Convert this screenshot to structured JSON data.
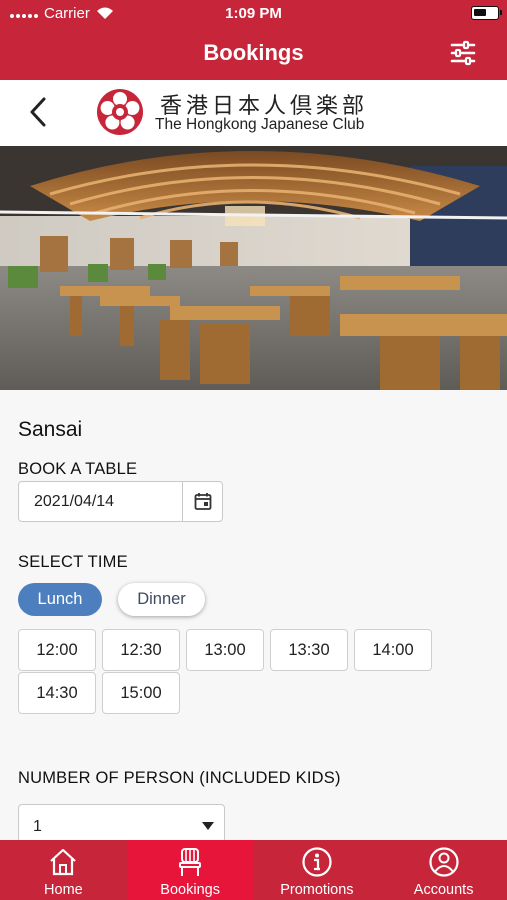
{
  "status_bar": {
    "carrier": "Carrier",
    "time": "1:09 PM"
  },
  "nav": {
    "title": "Bookings"
  },
  "club": {
    "name_cn": "香港日本人倶楽部",
    "name_en": "The Hongkong Japanese Club"
  },
  "restaurant": {
    "name": "Sansai"
  },
  "booking": {
    "book_table_label": "BOOK A TABLE",
    "date_value": "2021/04/14",
    "select_time_label": "SELECT TIME",
    "meals": [
      "Lunch",
      "Dinner"
    ],
    "selected_meal": "Lunch",
    "time_slots": [
      "12:00",
      "12:30",
      "13:00",
      "13:30",
      "14:00",
      "14:30",
      "15:00"
    ],
    "persons_label": "NUMBER OF PERSON (INCLUDED KIDS)",
    "persons_value": "1"
  },
  "tabs": [
    {
      "label": "Home",
      "icon": "home-icon"
    },
    {
      "label": "Bookings",
      "icon": "chair-icon",
      "active": true
    },
    {
      "label": "Promotions",
      "icon": "info-icon"
    },
    {
      "label": "Accounts",
      "icon": "user-icon"
    }
  ],
  "colors": {
    "brand_red": "#c7263a",
    "active_tab": "#e8153a",
    "selected_meal": "#4d7fbf"
  }
}
